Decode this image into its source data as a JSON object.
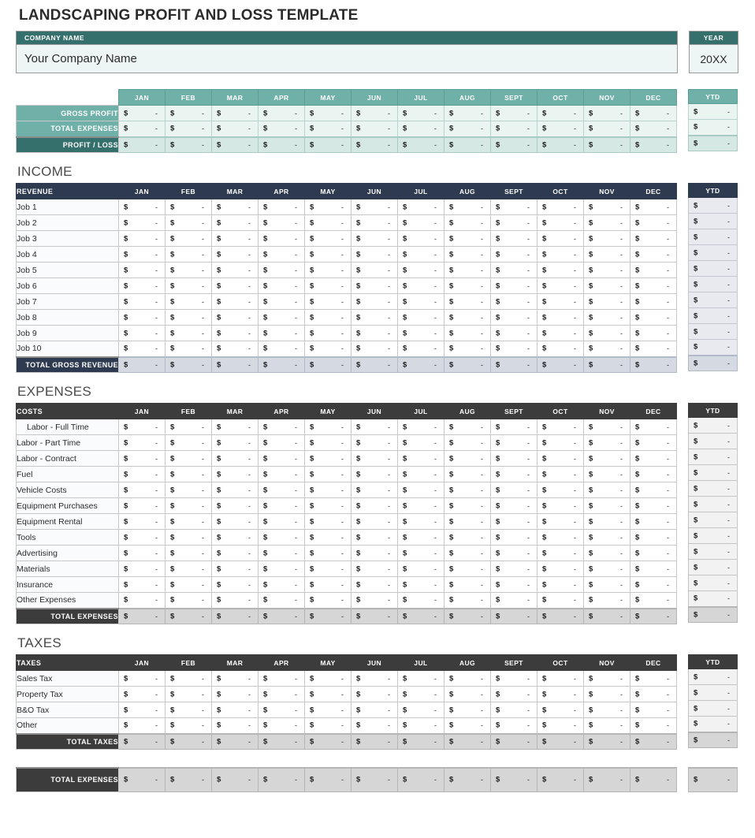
{
  "document": {
    "title": "LANDSCAPING PROFIT AND LOSS TEMPLATE"
  },
  "company": {
    "label": "COMPANY NAME",
    "value": "Your Company Name"
  },
  "year": {
    "label": "YEAR",
    "value": "20XX"
  },
  "months": [
    "JAN",
    "FEB",
    "MAR",
    "APR",
    "MAY",
    "JUN",
    "JUL",
    "AUG",
    "SEPT",
    "OCT",
    "NOV",
    "DEC"
  ],
  "ytd_label": "YTD",
  "cell": {
    "symbol": "$",
    "value": "-"
  },
  "summary": {
    "rows": [
      {
        "label": "GROSS PROFIT",
        "style": "teal"
      },
      {
        "label": "TOTAL EXPENSES",
        "style": "teal"
      },
      {
        "label": "PROFIT / LOSS",
        "style": "teal-dark"
      }
    ]
  },
  "income": {
    "section_title": "INCOME",
    "header": "REVENUE",
    "rows": [
      "Job 1",
      "Job 2",
      "Job 3",
      "Job 4",
      "Job 5",
      "Job 6",
      "Job 7",
      "Job 8",
      "Job 9",
      "Job 10"
    ],
    "total_label": "TOTAL GROSS REVENUE"
  },
  "expenses": {
    "section_title": "EXPENSES",
    "header": "COSTS",
    "rows": [
      "Labor - Full Time",
      "Labor - Part Time",
      "Labor - Contract",
      "Fuel",
      "Vehicle Costs",
      "Equipment Purchases",
      "Equipment Rental",
      "Tools",
      "Advertising",
      "Materials",
      "Insurance",
      "Other Expenses"
    ],
    "total_label": "TOTAL EXPENSES"
  },
  "taxes": {
    "section_title": "TAXES",
    "header": "TAXES",
    "rows": [
      "Sales Tax",
      "Property Tax",
      "B&O Tax",
      "Other"
    ],
    "total_label": "TOTAL TAXES"
  },
  "grand_total": {
    "label": "TOTAL EXPENSES"
  },
  "colors": {
    "teal_dark": "#35706c",
    "teal_mid": "#6fb0a8",
    "teal_light": "#eaf5f2",
    "navy": "#2d3a4f",
    "navy_light": "#d4d9e2",
    "gray_dark": "#3c3c3c",
    "gray_light": "#d6d6d6"
  }
}
